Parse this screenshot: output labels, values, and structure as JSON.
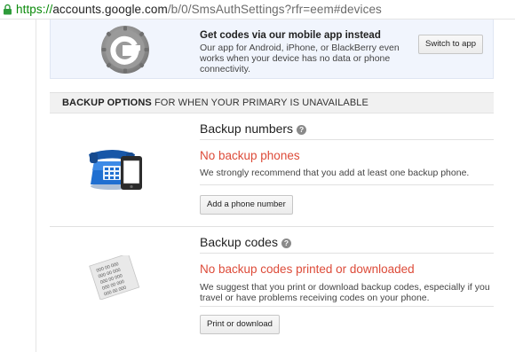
{
  "browser": {
    "url_scheme": "https://",
    "url_host": "accounts.google.com",
    "url_rest": "/b/0/SmsAuthSettings?rfr=eem#devices",
    "lock_icon": "lock-icon"
  },
  "promo": {
    "title": "Get codes via our mobile app instead",
    "description": "Our app for Android, iPhone, or BlackBerry even works when your device has no data or phone connectivity.",
    "button": "Switch to app",
    "icon": "google-authenticator-icon"
  },
  "backup_section": {
    "header_bold": "BACKUP OPTIONS",
    "header_rest": " FOR WHEN YOUR PRIMARY IS UNAVAILABLE"
  },
  "backup_numbers": {
    "title": "Backup numbers",
    "help": "?",
    "status": "No backup phones",
    "description": "We strongly recommend that you add at least one backup phone.",
    "button": "Add a phone number",
    "icon": "phone-icon"
  },
  "backup_codes": {
    "title": "Backup codes",
    "help": "?",
    "status": "No backup codes printed or downloaded",
    "description": "We suggest that you print or download backup codes, especially if you travel or have problems receiving codes on your phone.",
    "button": "Print or download",
    "icon": "codes-paper-icon",
    "paper_codes": [
      "000 00 000",
      "000 00 000",
      "000 00 000",
      "000 00 000",
      "000 00 000"
    ]
  },
  "colors": {
    "accent_red": "#dd4b39",
    "secure_green": "#0a8a0a",
    "promo_bg": "#f1f5fd"
  }
}
